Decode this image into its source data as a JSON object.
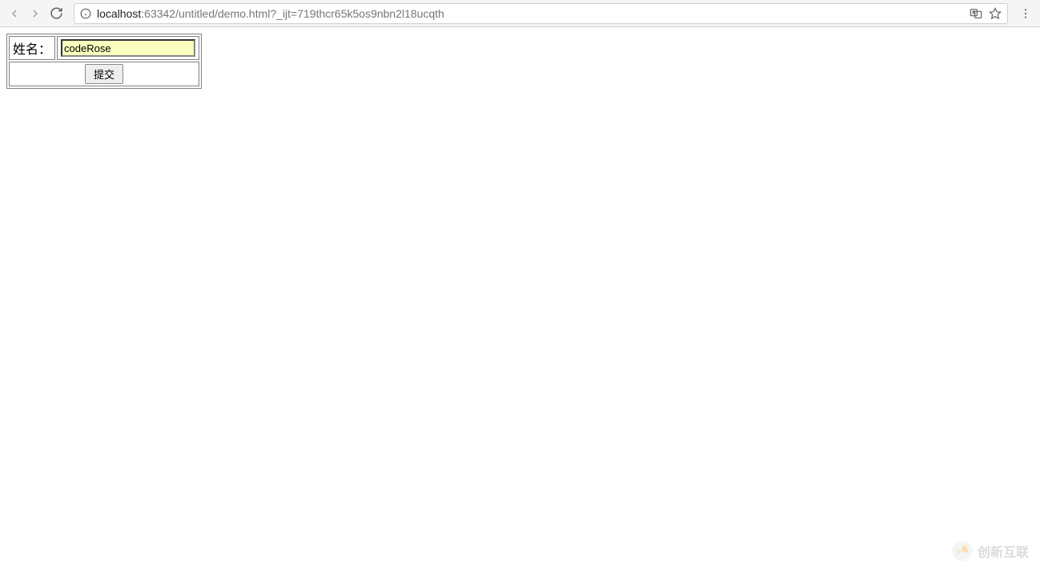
{
  "browser": {
    "url_host": "localhost",
    "url_path": ":63342/untitled/demo.html?_ijt=719thcr65k5os9nbn2l18ucqth"
  },
  "form": {
    "name_label": "姓名：",
    "name_value": "codeRose",
    "submit_label": "提交"
  },
  "watermark": {
    "text": "创新互联"
  }
}
